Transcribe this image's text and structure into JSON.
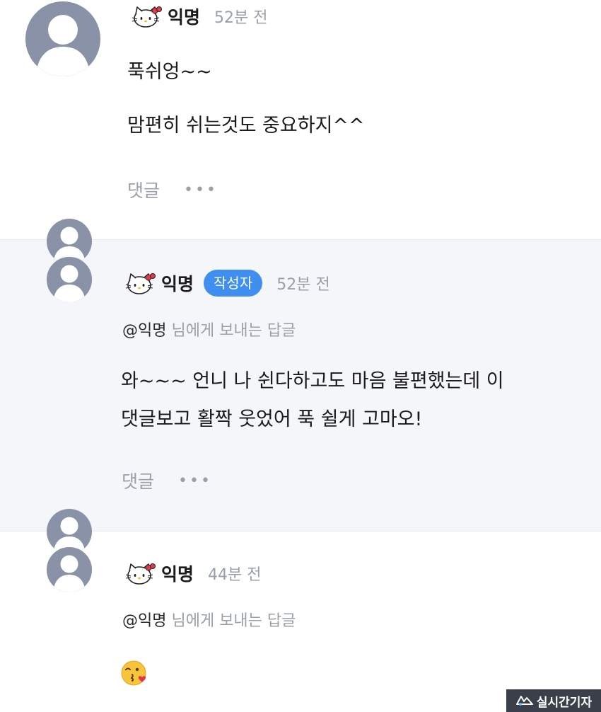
{
  "comments": [
    {
      "author": "익명",
      "time": "52분 전",
      "lines": [
        "푹쉬엉~~",
        "맘편히 쉬는것도 중요하지^^"
      ],
      "reply_label": "댓글",
      "more_label": "•••"
    },
    {
      "author": "익명",
      "badge": "작성자",
      "time": "52분 전",
      "reply_to_mention": "@익명",
      "reply_to_suffix": " 님에게 보내는 답글",
      "lines": [
        "와~~~ 언니 나 쉰다하고도 마음 불편했는데 이",
        "댓글보고 활짝 웃었어 푹 쉴게 고마오!"
      ],
      "reply_label": "댓글",
      "more_label": "•••"
    },
    {
      "author": "익명",
      "time": "44분 전",
      "reply_to_mention": "@익명",
      "reply_to_suffix": " 님에게 보내는 답글",
      "emoji": "face-blowing-a-kiss"
    }
  ],
  "watermark": {
    "text": "실시간기자"
  },
  "icons": {
    "avatar": "default-user-avatar-icon",
    "kitty": "hello-kitty-icon",
    "more": "more-dots-icon"
  },
  "colors": {
    "badge": "#3f8ff0",
    "avatar": "#8a92a8",
    "muted_text": "#9aa0a8",
    "reply_background": "#f4f6fa"
  }
}
